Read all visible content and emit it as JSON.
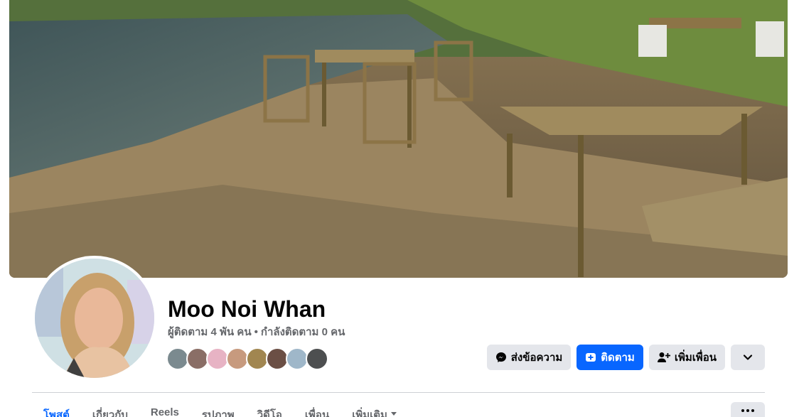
{
  "profile": {
    "name": "Moo Noi Whan",
    "followers_text": "ผู้ติดตาม 4 พัน คน",
    "separator": "•",
    "following_text": "กำลังติดตาม 0 คน"
  },
  "actions": {
    "message_label": "ส่งข้อความ",
    "follow_label": "ติดตาม",
    "add_friend_label": "เพิ่มเพื่อน"
  },
  "tabs": [
    {
      "label": "โพสต์"
    },
    {
      "label": "เกี่ยวกับ"
    },
    {
      "label": "Reels"
    },
    {
      "label": "รูปภาพ"
    },
    {
      "label": "วิดีโอ"
    },
    {
      "label": "เพื่อน"
    },
    {
      "label": "เพิ่มเติม"
    }
  ],
  "colors": {
    "accent": "#0866ff",
    "button_gray": "#e4e6eb",
    "secondary_text": "#65676b"
  },
  "icons": {
    "message": "messenger-icon",
    "follow": "follow-plus-icon",
    "add_friend": "add-person-icon",
    "expand": "chevron-down-icon",
    "more": "more-dots-icon",
    "tab_more": "caret-down-icon"
  }
}
